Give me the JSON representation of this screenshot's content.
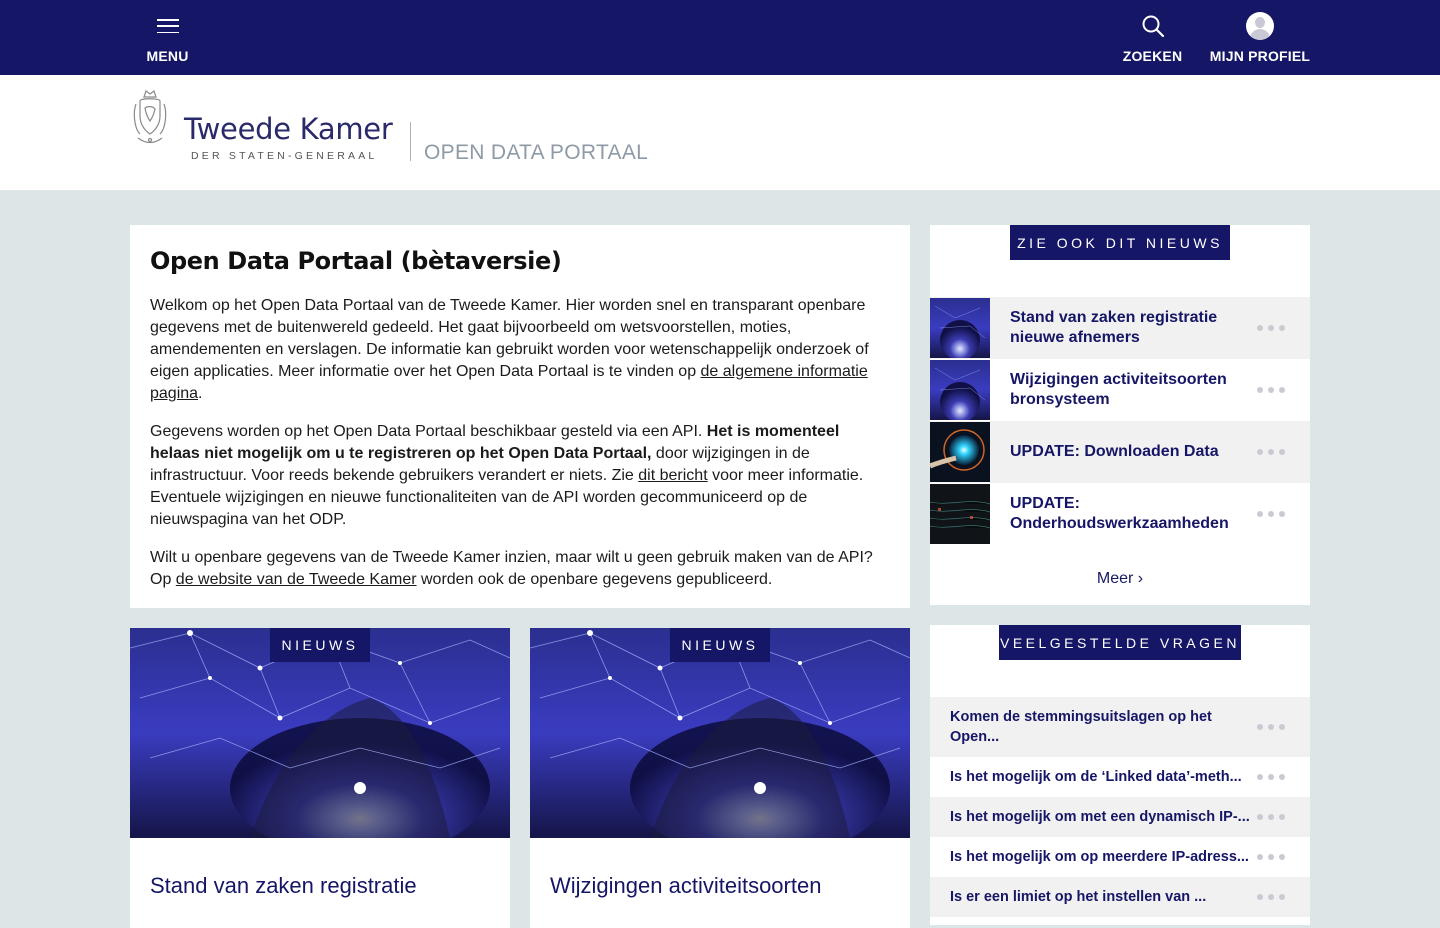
{
  "topbar": {
    "menu_label": "MENU",
    "search_label": "ZOEKEN",
    "profile_label": "MIJN PROFIEL"
  },
  "header": {
    "brand_name": "Tweede Kamer",
    "brand_sub": "DER STATEN-GENERAAL",
    "portal_title": "OPEN DATA PORTAAL"
  },
  "intro": {
    "title": "Open Data Portaal (bètaversie)",
    "p1_text": "Welkom op het Open Data Portaal van de Tweede Kamer. Hier worden snel en transparant openbare gegevens met de buitenwereld gedeeld. Het gaat bijvoorbeeld om wetsvoorstellen, moties, amendementen en verslagen. De informatie kan gebruikt worden voor wetenschappelijk onderzoek of eigen applicaties. Meer informatie over het Open Data Portaal is te vinden op ",
    "p1_link": "de algemene informatie pagina",
    "p1_end": ".",
    "p2_start": "Gegevens worden op het Open Data Portaal beschikbaar gesteld via een API. ",
    "p2_bold": "Het is momenteel helaas niet mogelijk om u te registreren op het Open Data Portaal,",
    "p2_mid": " door wijzigingen in de infrastructuur. Voor reeds bekende gebruikers verandert er niets. Zie ",
    "p2_link": "dit bericht",
    "p2_end": " voor meer informatie. Eventuele wijzigingen en nieuwe functionaliteiten van de API worden gecommuniceerd op de nieuwspagina van het ODP.",
    "p3_start": "Wilt u openbare gegevens van de Tweede Kamer inzien, maar wilt u geen gebruik maken van de API? Op ",
    "p3_link": "de website van de Tweede Kamer",
    "p3_end": " worden ook de openbare gegevens gepubliceerd."
  },
  "news_panel": {
    "badge": "ZIE OOK DIT NIEUWS",
    "items": [
      {
        "title": "Stand van zaken registratie nieuwe afnemers"
      },
      {
        "title": "Wijzigingen activiteitsoorten bronsysteem"
      },
      {
        "title": "UPDATE: Downloaden Data"
      },
      {
        "title": "UPDATE: Onderhoudswerkzaamheden"
      }
    ],
    "more_label": "Meer ›"
  },
  "faq_panel": {
    "badge": "VEELGESTELDE VRAGEN",
    "items": [
      {
        "question": "Komen de stemmingsuitslagen op het Open..."
      },
      {
        "question": "Is het mogelijk om de ‘Linked data’-meth..."
      },
      {
        "question": "Is het mogelijk om met een dynamisch IP-..."
      },
      {
        "question": "Is het mogelijk om op meerdere IP-adress..."
      },
      {
        "question": "Is er een limiet op het instellen van ..."
      }
    ]
  },
  "cards": [
    {
      "badge": "NIEUWS",
      "title": "Stand van zaken registratie"
    },
    {
      "badge": "NIEUWS",
      "title": "Wijzigingen activiteitsoorten"
    }
  ],
  "colors": {
    "primary": "#161666",
    "background": "#dce6e6",
    "row_alt": "#f1f1f1",
    "portal_title": "#8e9aa6"
  }
}
